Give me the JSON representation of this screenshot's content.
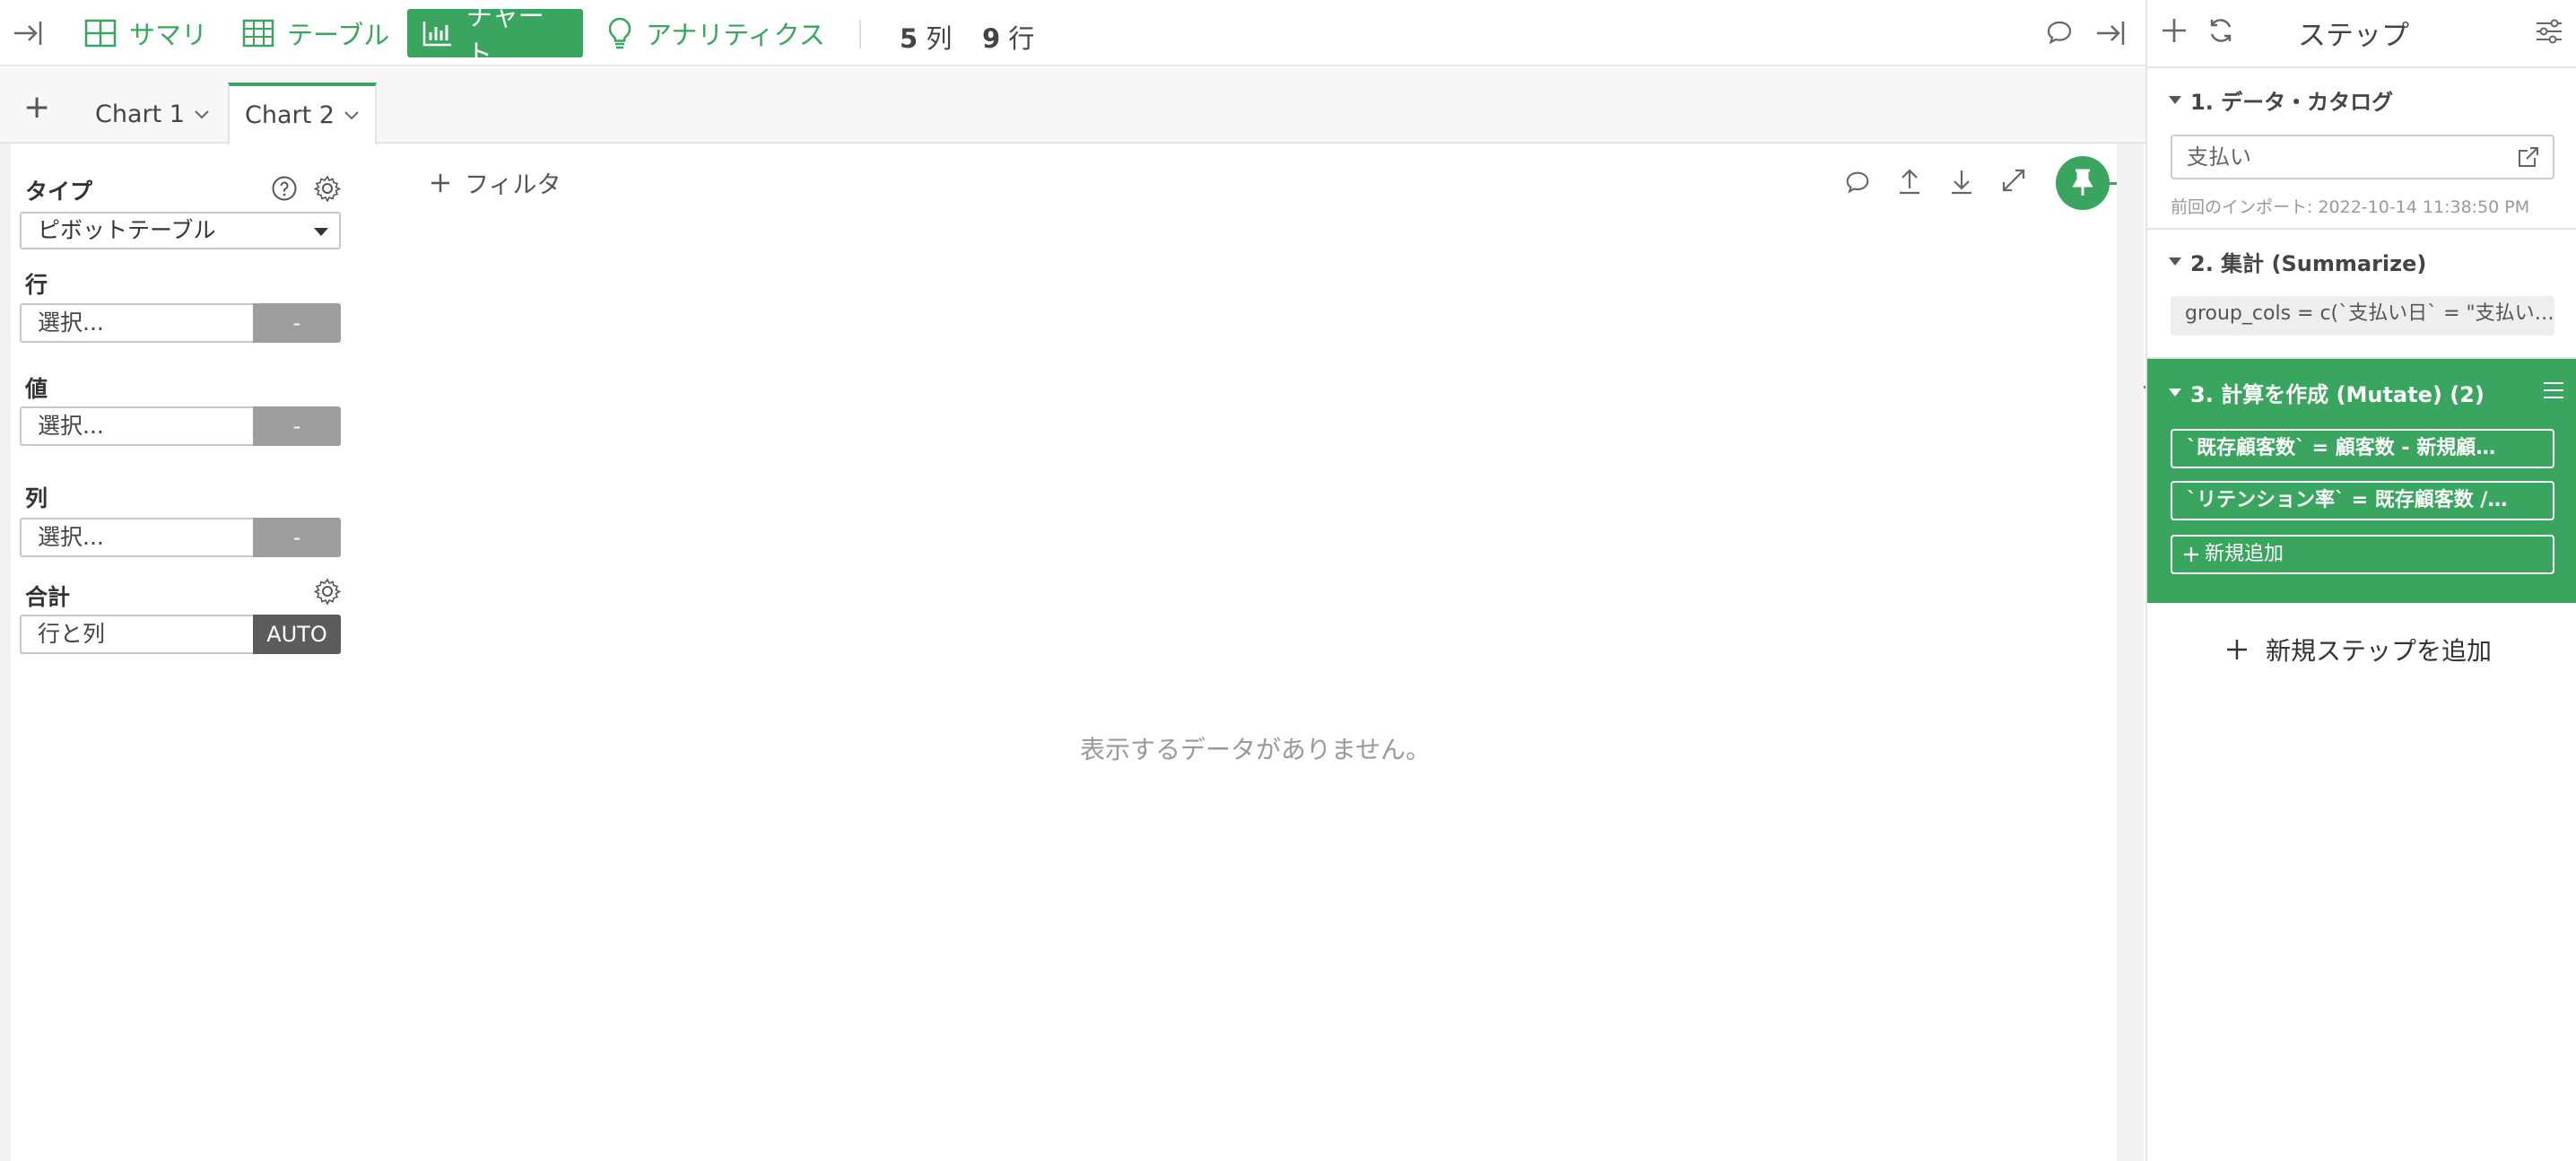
{
  "toolbar": {
    "tabs": [
      {
        "label": "サマリ",
        "icon": "summary-grid-icon"
      },
      {
        "label": "テーブル",
        "icon": "table-icon"
      },
      {
        "label": "チャート",
        "icon": "bar-chart-icon"
      },
      {
        "label": "アナリティクス",
        "icon": "lightbulb-icon"
      }
    ],
    "columns_count": "5",
    "columns_unit": "列",
    "rows_count": "9",
    "rows_unit": "行"
  },
  "chart_tabs": {
    "add": "+",
    "tabs": [
      {
        "label": "Chart 1"
      },
      {
        "label": "Chart 2"
      }
    ]
  },
  "config": {
    "type_label": "タイプ",
    "type_value": "ピボットテーブル",
    "row_label": "行",
    "row_placeholder": "選択...",
    "row_button": "-",
    "value_label": "値",
    "value_placeholder": "選択...",
    "value_button": "-",
    "column_label": "列",
    "column_placeholder": "選択...",
    "column_button": "-",
    "total_label": "合計",
    "total_value": "行と列",
    "total_button": "AUTO"
  },
  "chart_area": {
    "filter_label": "フィルタ",
    "empty_message": "表示するデータがありません。"
  },
  "steps_panel": {
    "title": "ステップ",
    "steps": [
      {
        "title": "1. データ・カタログ",
        "value": "支払い",
        "note": "前回のインポート: 2022-10-14 11:38:50 PM"
      },
      {
        "title": "2. 集計 (Summarize)",
        "value": "group_cols = c(`支払い日` = \"支払い…"
      },
      {
        "title": "3. 計算を作成 (Mutate) (2)",
        "items": [
          "`既存顧客数` = 顧客数 - 新規顧…",
          "`リテンション率` = 既存顧客数 /…"
        ],
        "add_label": "新規追加"
      }
    ],
    "add_step_label": "新規ステップを追加"
  },
  "colors": {
    "accent": "#3aa55e",
    "button_gray": "#9e9e9e",
    "button_dark": "#5c5c5c"
  }
}
